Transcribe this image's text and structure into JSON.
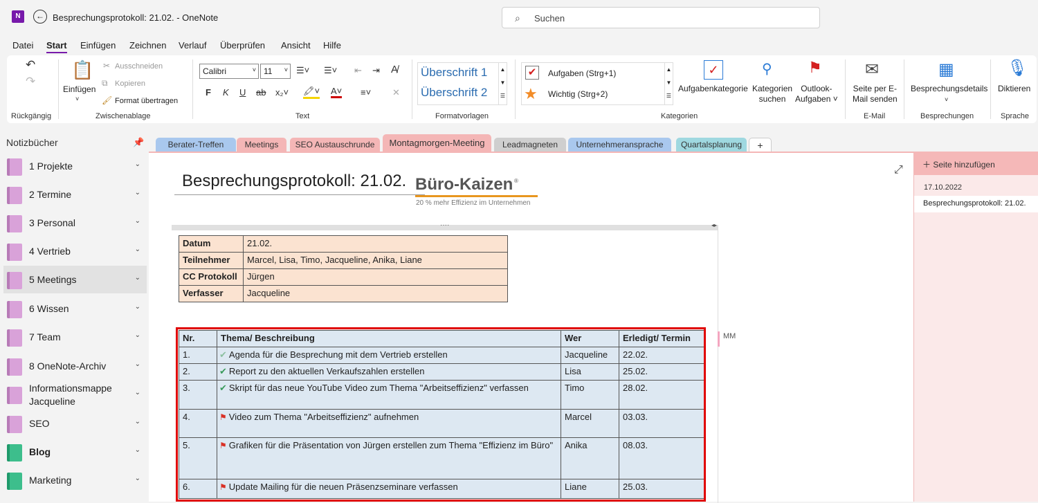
{
  "titlebar": {
    "app_icon": "N",
    "title": "Besprechungsprotokoll: 21.02.  -  OneNote",
    "search_placeholder": "Suchen"
  },
  "menu": [
    "Datei",
    "Start",
    "Einfügen",
    "Zeichnen",
    "Verlauf",
    "Überprüfen",
    "Ansicht",
    "Hilfe"
  ],
  "ribbon": {
    "groups": {
      "undo": "Rückgängig",
      "clipboard": "Zwischenablage",
      "text": "Text",
      "styles": "Formatvorlagen",
      "categories": "Kategorien",
      "email": "E-Mail",
      "meetings": "Besprechungen",
      "voice": "Sprache"
    },
    "paste": "Einfügen",
    "cut": "Ausschneiden",
    "copy": "Kopieren",
    "format_painter": "Format übertragen",
    "font": "Calibri",
    "font_size": "11",
    "heading1": "Überschrift 1",
    "heading2": "Überschrift 2",
    "tag_tasks": "Aufgaben (Strg+1)",
    "tag_important": "Wichtig (Strg+2)",
    "task_category": "Aufgabenkategorie",
    "find_categories": [
      "Kategorien",
      "suchen"
    ],
    "outlook_tasks": [
      "Outlook-",
      "Aufgaben ˅"
    ],
    "email_page": [
      "Seite per E-",
      "Mail senden"
    ],
    "meeting_details": "Besprechungsdetails",
    "dictate": "Diktieren"
  },
  "sidebar": {
    "header": "Notizbücher",
    "notebooks": [
      {
        "label": "1 Projekte",
        "color": "#d9a2d9"
      },
      {
        "label": "2 Termine",
        "color": "#d9a2d9"
      },
      {
        "label": "3 Personal",
        "color": "#d9a2d9"
      },
      {
        "label": "4 Vertrieb",
        "color": "#d9a2d9"
      },
      {
        "label": "5 Meetings",
        "color": "#d9a2d9"
      },
      {
        "label": "6 Wissen",
        "color": "#d9a2d9"
      },
      {
        "label": "7 Team",
        "color": "#d9a2d9"
      },
      {
        "label": "8 OneNote-Archiv",
        "color": "#d9a2d9"
      },
      {
        "label": "Informationsmappe Jacqueline",
        "color": "#d9a2d9"
      },
      {
        "label": "SEO",
        "color": "#d9a2d9"
      },
      {
        "label": "Blog",
        "color": "#3dbe8c"
      },
      {
        "label": "Marketing",
        "color": "#3dbe8c"
      }
    ]
  },
  "tabs": [
    {
      "label": "Berater-Treffen",
      "color": "#a9c8ee"
    },
    {
      "label": "Meetings",
      "color": "#f4b6b6"
    },
    {
      "label": "SEO Austauschrunde",
      "color": "#f4b6b6"
    },
    {
      "label": "Montagmorgen-Meeting",
      "color": "#f4b6b6"
    },
    {
      "label": "Leadmagneten",
      "color": "#cfcfcf"
    },
    {
      "label": "Unternehmeransprache",
      "color": "#a9c8ee"
    },
    {
      "label": "Quartalsplanung",
      "color": "#9fd8e0"
    },
    {
      "label": "+",
      "color": "#ffffff"
    }
  ],
  "pagelist": {
    "add_page": "Seite hinzufügen",
    "date": "17.10.2022",
    "page_title": "Besprechungsprotokoll: 21.02."
  },
  "page": {
    "title": "Besprechungsprotokoll: 21.02.",
    "logo": "Büro-Kaizen",
    "logo_mark": "®",
    "tagline": "20 % mehr Effizienz im Unternehmen",
    "container_handle": "····",
    "info": [
      {
        "key": "Datum",
        "value": "21.02."
      },
      {
        "key": "Teilnehmer",
        "value": "Marcel, Lisa, Timo, Jacqueline, Anika, Liane"
      },
      {
        "key": "CC Protokoll",
        "value": "Jürgen"
      },
      {
        "key": "Verfasser",
        "value": "Jacqueline"
      }
    ],
    "todo_headers": [
      "Nr.",
      "Thema/ Beschreibung",
      "Wer",
      "Erledigt/ Termin"
    ],
    "todos": [
      {
        "nr": "1.",
        "desc": "Agenda für die Besprechung mit dem Vertrieb erstellen",
        "who": "Jacqueline",
        "due": "22.02."
      },
      {
        "nr": "2.",
        "desc": "Report zu den aktuellen Verkaufszahlen erstellen",
        "who": "Lisa",
        "due": "25.02."
      },
      {
        "nr": "3.",
        "desc": "Skript für das neue YouTube Video zum Thema \"Arbeitseffizienz\" verfassen",
        "who": "Timo",
        "due": "28.02."
      },
      {
        "nr": "4.",
        "desc": "Video zum Thema \"Arbeitseffizienz\" aufnehmen",
        "who": "Marcel",
        "due": "03.03."
      },
      {
        "nr": "5.",
        "desc": "Grafiken für die Präsentation von Jürgen erstellen zum Thema \"Effizienz im Büro\"",
        "who": "Anika",
        "due": "08.03."
      },
      {
        "nr": "6.",
        "desc": "Update Mailing für die neuen Präsenzseminare verfassen",
        "who": "Liane",
        "due": "25.03."
      }
    ],
    "author_mark": "MM"
  }
}
